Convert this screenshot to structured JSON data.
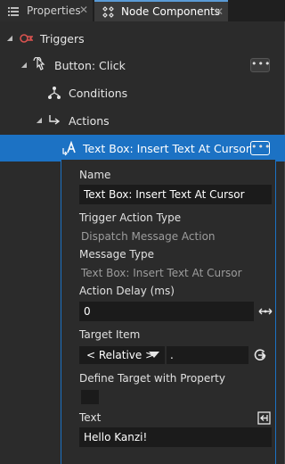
{
  "tabs": [
    {
      "label": "Properties",
      "icon": "list-icon",
      "active": false
    },
    {
      "label": "Node Components",
      "icon": "components-icon",
      "active": true
    }
  ],
  "tree": {
    "triggers": "Triggers",
    "button_click": "Button: Click",
    "conditions": "Conditions",
    "actions": "Actions",
    "selected_action": "Text Box: Insert Text At Cursor",
    "more_label": "•••"
  },
  "properties": {
    "name_label": "Name",
    "name_value": "Text Box: Insert Text At Cursor",
    "trigger_action_type_label": "Trigger Action Type",
    "trigger_action_type_value": "Dispatch Message Action",
    "message_type_label": "Message Type",
    "message_type_value": "Text Box: Insert Text At Cursor",
    "action_delay_label": "Action Delay (ms)",
    "action_delay_value": "0",
    "target_item_label": "Target Item",
    "target_item_mode": "< Relative >",
    "target_item_path": ".",
    "define_target_label": "Define Target with Property",
    "define_target_checked": false,
    "text_label": "Text",
    "text_value": "Hello Kanzi!"
  },
  "colors": {
    "accent": "#1c72c4",
    "background": "#2b2b2b",
    "field_bg": "#1b1b1b",
    "trigger_icon": "#d9534f"
  }
}
